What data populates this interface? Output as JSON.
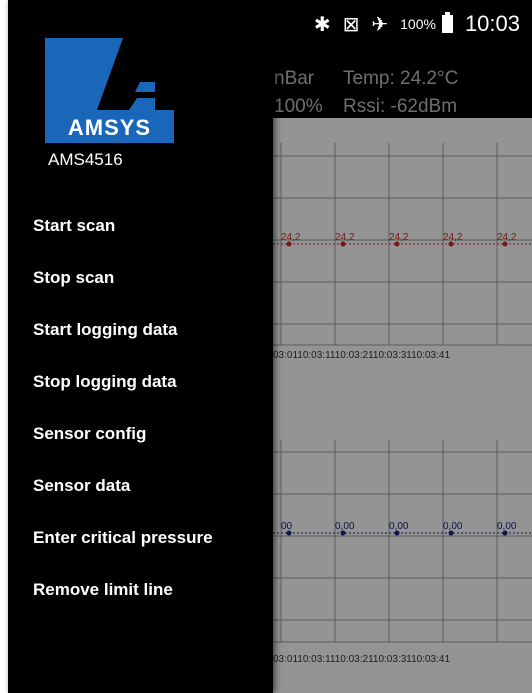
{
  "status_bar": {
    "icons": [
      "bluetooth-icon",
      "no-signal-icon",
      "airplane-icon",
      "battery-icon"
    ],
    "battery_pct": "100%",
    "time": "10:03"
  },
  "header": {
    "pressure_partial": "nBar",
    "temp": "Temp: 24.2°C",
    "humidity_partial": "100%",
    "rssi": "Rssi: -62dBm"
  },
  "drawer": {
    "logo_text": "AMSYS",
    "device_name": "AMS4516",
    "items": [
      {
        "label": "Start scan"
      },
      {
        "label": "Stop scan"
      },
      {
        "label": "Start logging data"
      },
      {
        "label": "Stop logging data"
      },
      {
        "label": "Sensor config"
      },
      {
        "label": "Sensor data"
      },
      {
        "label": "Enter critical pressure"
      },
      {
        "label": "Remove limit line"
      }
    ]
  },
  "graphs": {
    "temperature": {
      "point_labels": [
        "24,2",
        "24,2",
        "24,2",
        "24,2",
        "24,2"
      ],
      "x_ticks": "03:0110:03:1110:03:2110:03:3110:03:41",
      "color": "#c62828"
    },
    "pressure": {
      "point_labels": [
        "00",
        "0,00",
        "0,00",
        "0,00",
        "0,00"
      ],
      "x_ticks": "03:0110:03:1110:03:2110:03:3110:03:41",
      "color": "#1a237e"
    }
  },
  "colors": {
    "drawer_bg": "#000000",
    "logo_blue": "#1a66b8"
  }
}
